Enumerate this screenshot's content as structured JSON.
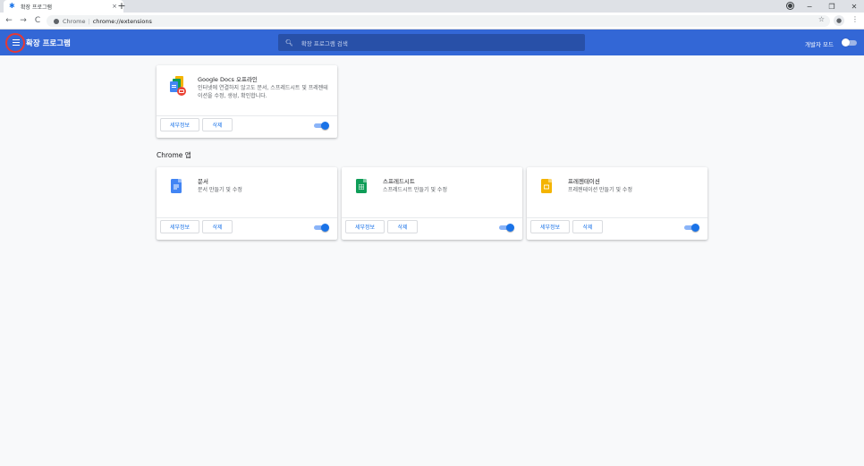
{
  "browser": {
    "tab_title": "확장 프로그램",
    "tab_close": "×",
    "new_tab": "+",
    "omnibox_host": "Chrome",
    "omnibox_sep": "|",
    "omnibox_path": "chrome://extensions",
    "win_min": "−",
    "win_restore": "❐",
    "win_close": "✕",
    "nav_back": "←",
    "nav_forward": "→",
    "nav_reload": "C",
    "star": "☆",
    "menu": "⋮"
  },
  "header": {
    "title": "확장 프로그램",
    "search_placeholder": "확장 프로그램 검색",
    "dev_mode_label": "개발자 모드",
    "dev_mode_on": false
  },
  "extensions": [
    {
      "name": "Google Docs 오프라인",
      "description": "인터넷에 연결하지 않고도 문서, 스프레드시트 및 프레젠테이션을 수정, 생성, 확인합니다.",
      "details_label": "세부정보",
      "remove_label": "삭제",
      "enabled": true
    }
  ],
  "apps_section_title": "Chrome 앱",
  "apps": [
    {
      "name": "문서",
      "description": "문서 만들기 및 수정",
      "details_label": "세부정보",
      "remove_label": "삭제",
      "enabled": true,
      "icon_color": "#4285f4"
    },
    {
      "name": "스프레드시트",
      "description": "스프레드시트 만들기 및 수정",
      "details_label": "세부정보",
      "remove_label": "삭제",
      "enabled": true,
      "icon_color": "#0f9d58"
    },
    {
      "name": "프레젠테이션",
      "description": "프레젠테이션 만들기 및 수정",
      "details_label": "세부정보",
      "remove_label": "삭제",
      "enabled": true,
      "icon_color": "#f4b400"
    }
  ],
  "colors": {
    "header_bg": "#3367d6",
    "accent": "#1a73e8",
    "highlight_ring": "#e53935"
  }
}
